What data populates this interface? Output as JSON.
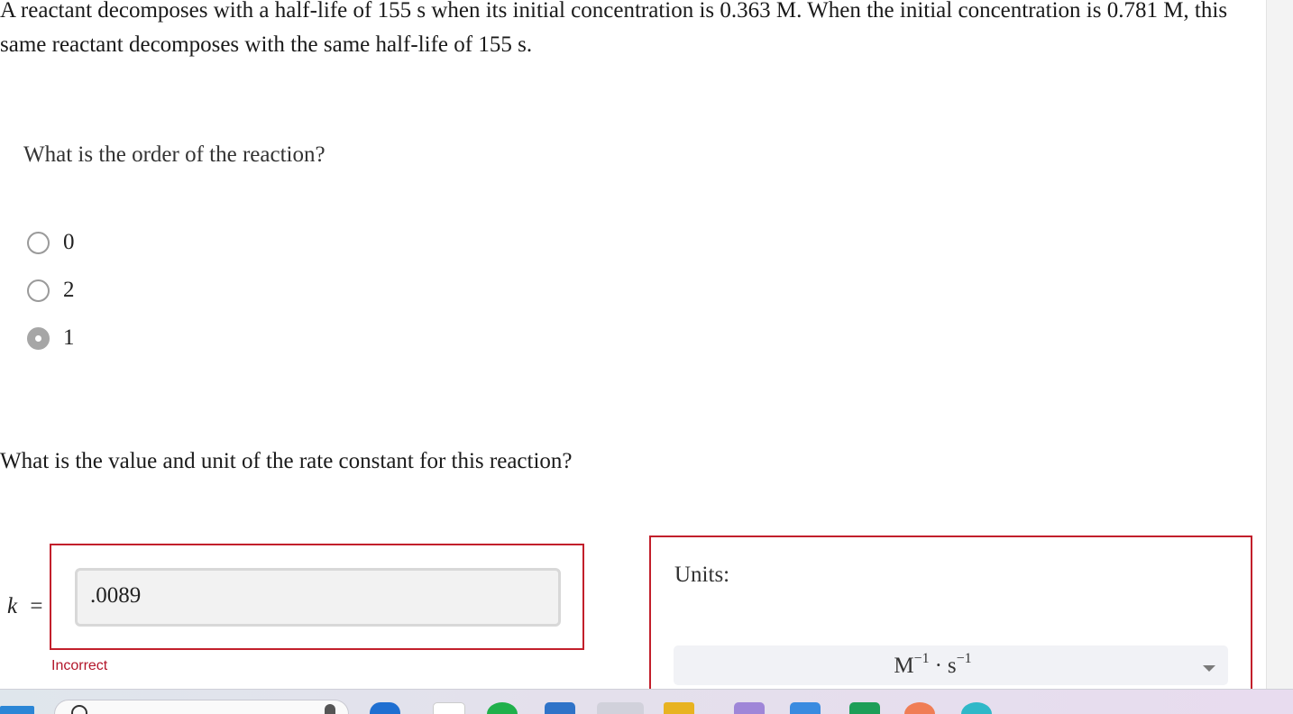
{
  "problem": {
    "intro_text": "A reactant decomposes with a half-life of 155 s when its initial concentration is 0.363 M. When the initial concentration is 0.781 M, this same reactant decomposes with the same half-life of 155 s."
  },
  "question1": {
    "prompt": "What is the order of the reaction?",
    "options": [
      {
        "label": "0",
        "selected": false
      },
      {
        "label": "2",
        "selected": false
      },
      {
        "label": "1",
        "selected": true
      }
    ]
  },
  "question2": {
    "prompt": "What is the value and unit of the rate constant for this reaction?",
    "k_symbol": "k",
    "equals": "=",
    "answer_value": ".0089",
    "feedback": "Incorrect",
    "units_label": "Units:",
    "units_selected": {
      "base1": "M",
      "exp1": "−1",
      "sep": "·",
      "base2": "s",
      "exp2": "−1"
    }
  },
  "colors": {
    "error_border": "#c21f2b",
    "error_text": "#b3162a",
    "radio_selected": "#a6a6a6",
    "input_bg": "#f2f2f2"
  },
  "taskbar": {
    "icons": [
      "windows-start-icon",
      "search-icon",
      "widgets-icon",
      "browser-icon",
      "chat-icon",
      "mail-icon",
      "chrome-icon",
      "file-explorer-icon",
      "photos-icon",
      "vscode-icon",
      "sheets-icon",
      "app-icon",
      "edge-icon"
    ]
  }
}
